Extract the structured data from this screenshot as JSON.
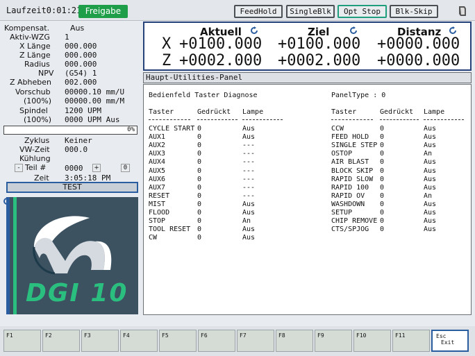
{
  "topbar": {
    "runtime": "Laufzeit0:01:21",
    "status": "Freigabe",
    "buttons": [
      "FeedHold",
      "SingleBlk",
      "Opt Stop",
      "Blk-Skip"
    ]
  },
  "status": {
    "kompensat_label": "Kompensat.",
    "kompensat_value": "Aus",
    "tool_label": "Aktiv-WZG",
    "tool_value": "1",
    "xlen_label": "X Länge",
    "xlen_value": "000.000",
    "zlen_label": "Z Länge",
    "zlen_value": "000.000",
    "radius_label": "Radius",
    "radius_value": "000.000",
    "npv_label": "NPV",
    "npv_value": "(G54) 1",
    "zab_label": "Z Abheben",
    "zab_value": "002.000",
    "feed_label": "Vorschub",
    "feed_value": "00000.10 mm/U",
    "feedpct_label": "(100%)",
    "feedpct_value": "00000.00 mm/M",
    "spindle_label": "Spindel",
    "spindle_value": "1200 UPM",
    "spindlepct_label": "(100%)",
    "spindlepct_value": "0000 UPM Aus",
    "progress": "0%",
    "cycle_label": "Zyklus",
    "cycle_value": "Keiner",
    "vw_label": "VW-Zeit",
    "vw_value": "000.0",
    "cool_label": "Kühlung",
    "part_label": "Teil #",
    "part_value": "0000",
    "part_count": "0",
    "time_label": "Zeit",
    "time_value": "3:05:18 PM",
    "minus": "-",
    "plus": "+",
    "test_button": "TEST"
  },
  "coords": {
    "headers": [
      "Aktuell",
      "Ziel",
      "Distanz"
    ],
    "axes": [
      {
        "axis": "X",
        "actual": "+0100.000",
        "target": "+0100.000",
        "distance": "+0000.000"
      },
      {
        "axis": "Z",
        "actual": "+0002.000",
        "target": "+0002.000",
        "distance": "+0000.000"
      }
    ]
  },
  "panel": {
    "title": "Haupt-Utilities-Panel",
    "heading": "Bedienfeld Taster Diagnose",
    "panel_type": "PanelType : 0",
    "col_headers": [
      "Taster",
      "Gedrückt",
      "Lampe"
    ],
    "left_rows": [
      [
        "CYCLE START",
        "0",
        "Aus"
      ],
      [
        "AUX1",
        "0",
        "Aus"
      ],
      [
        "AUX2",
        "0",
        "---"
      ],
      [
        "AUX3",
        "0",
        "---"
      ],
      [
        "AUX4",
        "0",
        "---"
      ],
      [
        "AUX5",
        "0",
        "---"
      ],
      [
        "AUX6",
        "0",
        "---"
      ],
      [
        "AUX7",
        "0",
        "---"
      ],
      [
        "RESET",
        "0",
        "---"
      ],
      [
        "MIST",
        "0",
        "Aus"
      ],
      [
        "FLOOD",
        "0",
        "Aus"
      ],
      [
        "STOP",
        "0",
        "An"
      ],
      [
        "TOOL RESET",
        "0",
        "Aus"
      ],
      [
        "CW",
        "0",
        "Aus"
      ]
    ],
    "right_rows": [
      [
        "CCW",
        "0",
        "Aus"
      ],
      [
        "FEED HOLD",
        "0",
        "Aus"
      ],
      [
        "SINGLE STEP",
        "0",
        "Aus"
      ],
      [
        "OSTOP",
        "0",
        "An"
      ],
      [
        "AIR BLAST",
        "0",
        "Aus"
      ],
      [
        "BLOCK SKIP",
        "0",
        "Aus"
      ],
      [
        "RAPID SLOW",
        "0",
        "Aus"
      ],
      [
        "RAPID 100",
        "0",
        "Aus"
      ],
      [
        "RAPID OV",
        "0",
        "An"
      ],
      [
        "WASHDOWN",
        "0",
        "Aus"
      ],
      [
        "SETUP",
        "0",
        "Aus"
      ],
      [
        "CHIP REMOVE",
        "0",
        "Aus"
      ],
      [
        "CTS/SPJOG",
        "0",
        "Aus"
      ]
    ]
  },
  "logo": {
    "text": "DGI 10"
  },
  "fkeys": [
    "F1",
    "F2",
    "F3",
    "F4",
    "F5",
    "F6",
    "F7",
    "F8",
    "F9",
    "F10",
    "F11"
  ],
  "esc_key": {
    "line1": "Esc",
    "line2": "Exit"
  },
  "colors": {
    "accent_blue": "#25437a",
    "status_green": "#1f9e4a",
    "logo_bg": "#3c5261",
    "logo_green": "#2bbf7f"
  }
}
